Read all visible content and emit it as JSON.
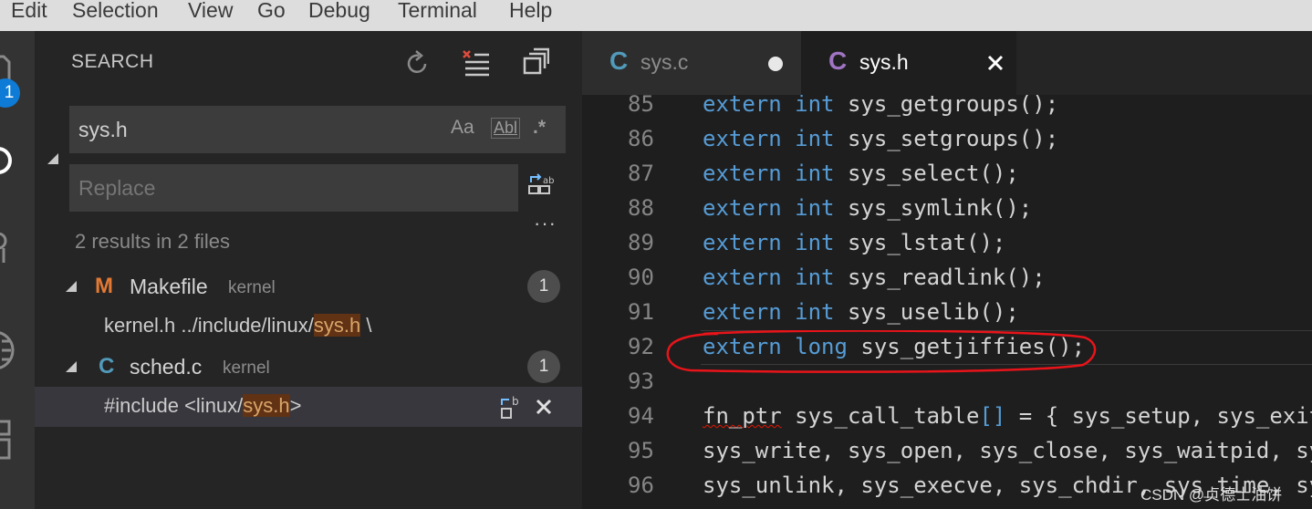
{
  "menu": [
    "Edit",
    "Selection",
    "View",
    "Go",
    "Debug",
    "Terminal",
    "Help"
  ],
  "activity_bar": {
    "badge": "1"
  },
  "sidebar": {
    "title": "SEARCH",
    "search": {
      "value": "sys.h",
      "options": [
        "Aa",
        "Abl",
        ".*"
      ]
    },
    "replace": {
      "placeholder": "Replace"
    },
    "more": "···",
    "summary": "2 results in 2 files",
    "results": [
      {
        "icon": "M",
        "icon_color": "#e37933",
        "file": "Makefile",
        "dir": "kernel",
        "count": "1",
        "match": {
          "pre": "kernel.h ../include/linux/",
          "hit": "sys.h",
          "post": " \\"
        }
      },
      {
        "icon": "C",
        "icon_color": "#519aba",
        "file": "sched.c",
        "dir": "kernel",
        "count": "1",
        "match": {
          "pre": "#include <linux/",
          "hit": "sys.h",
          "post": ">"
        }
      }
    ]
  },
  "tabs": [
    {
      "icon": "C",
      "label": "sys.c",
      "modified": true,
      "active": false,
      "color": "#519aba"
    },
    {
      "icon": "C",
      "label": "sys.h",
      "modified": false,
      "active": true,
      "color": "#a074c4"
    }
  ],
  "editor": {
    "lines": [
      {
        "num": "85",
        "kw": [
          "extern",
          "int"
        ],
        "rest": "sys_getgroups();"
      },
      {
        "num": "86",
        "kw": [
          "extern",
          "int"
        ],
        "rest": "sys_setgroups();"
      },
      {
        "num": "87",
        "kw": [
          "extern",
          "int"
        ],
        "rest": "sys_select();"
      },
      {
        "num": "88",
        "kw": [
          "extern",
          "int"
        ],
        "rest": "sys_symlink();"
      },
      {
        "num": "89",
        "kw": [
          "extern",
          "int"
        ],
        "rest": "sys_lstat();"
      },
      {
        "num": "90",
        "kw": [
          "extern",
          "int"
        ],
        "rest": "sys_readlink();"
      },
      {
        "num": "91",
        "kw": [
          "extern",
          "int"
        ],
        "rest": "sys_uselib();"
      },
      {
        "num": "92",
        "kw": [
          "extern",
          "long"
        ],
        "rest": "sys_getjiffies();"
      },
      {
        "num": "93",
        "kw": [],
        "rest": ""
      },
      {
        "num": "94",
        "kw": [],
        "rest": "fn_ptr sys_call_table[] = { sys_setup, sys_exit,"
      },
      {
        "num": "95",
        "kw": [],
        "rest": "sys_write, sys_open, sys_close, sys_waitpid, sys"
      },
      {
        "num": "96",
        "kw": [],
        "rest": "sys_unlink, sys_execve, sys_chdir, sys_time, sys"
      }
    ]
  },
  "watermark": "CSDN @贞德士油饼",
  "colors": {
    "keyword": "#569cd6",
    "annotation": "#e8141a",
    "highlight": "#613214"
  }
}
